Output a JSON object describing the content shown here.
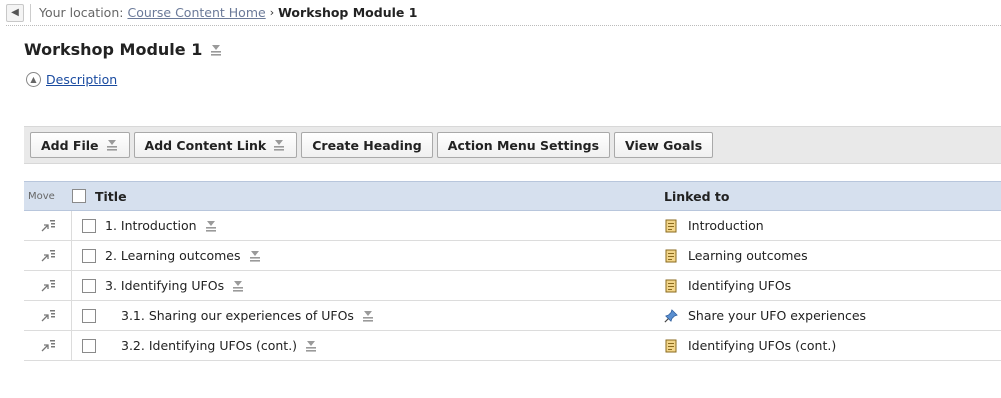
{
  "breadcrumb": {
    "prefix": "Your location:",
    "home_link": "Course Content Home",
    "separator": "›",
    "current": "Workshop Module 1"
  },
  "page": {
    "title": "Workshop Module 1",
    "description_link": " Description"
  },
  "toolbar": {
    "add_file": "Add File",
    "add_content_link": "Add Content Link",
    "create_heading": "Create Heading",
    "action_menu_settings": "Action Menu Settings",
    "view_goals": "View Goals"
  },
  "table": {
    "columns": {
      "move": "Move",
      "title": "Title",
      "linked_to": "Linked to"
    },
    "rows": [
      {
        "title": "1. Introduction",
        "linked": "Introduction",
        "link_icon": "page-icon"
      },
      {
        "title": "2. Learning outcomes",
        "linked": "Learning outcomes",
        "link_icon": "page-icon"
      },
      {
        "title": "3. Identifying UFOs",
        "linked": "Identifying UFOs",
        "link_icon": "page-icon"
      },
      {
        "title": "3.1. Sharing our experiences of UFOs",
        "linked": "Share your UFO experiences",
        "link_icon": "pin-icon"
      },
      {
        "title": "3.2. Identifying UFOs (cont.)",
        "linked": "Identifying UFOs (cont.)",
        "link_icon": "page-icon"
      }
    ]
  },
  "colors": {
    "header_bg": "#d6e0ee",
    "toolbar_bg": "#e9e9e9",
    "link_color": "#1a4ba0"
  }
}
